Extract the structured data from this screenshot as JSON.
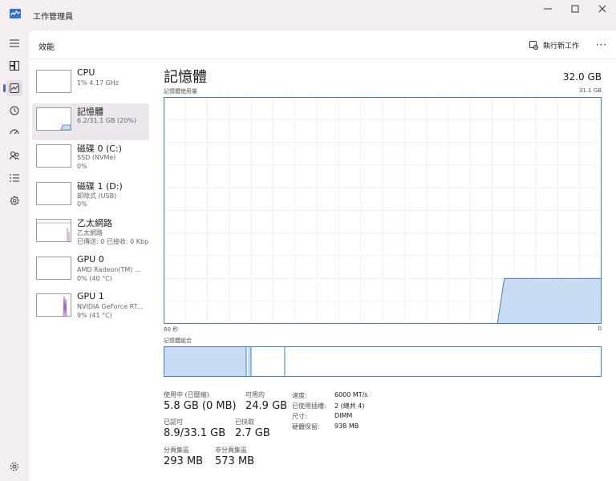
{
  "window": {
    "title": "工作管理員"
  },
  "header": {
    "page_title": "效能",
    "run_task_label": "執行新工作",
    "more_label": "···"
  },
  "devices": [
    {
      "name": "CPU",
      "line2": "1% 4.17 GHz",
      "line3": ""
    },
    {
      "name": "記憶體",
      "line2": "6.2/31.1 GB (20%)",
      "line3": ""
    },
    {
      "name": "磁碟 0 (C:)",
      "line2": "SSD (NVMe)",
      "line3": "0%"
    },
    {
      "name": "磁碟 1 (D:)",
      "line2": "卸除式 (USB)",
      "line3": "0%"
    },
    {
      "name": "乙太網路",
      "line2": "乙太網路",
      "line3": "已傳送: 0 已接收: 0 Kbp"
    },
    {
      "name": "GPU 0",
      "line2": "AMD Radeon(TM) ...",
      "line3": "0% (40 °C)"
    },
    {
      "name": "GPU 1",
      "line2": "NVIDIA GeForce RT...",
      "line3": "9% (41 °C)"
    }
  ],
  "main": {
    "title": "記憶體",
    "total": "32.0 GB",
    "graph_label": "記憶體使用量",
    "graph_max": "31.1 GB",
    "axis_left": "60 秒",
    "axis_right": "0",
    "composition_label": "記憶體組合",
    "usage_fraction_latest": 0.2
  },
  "stats": {
    "in_use_label": "使用中 (已壓縮)",
    "in_use_value": "5.8 GB (0 MB)",
    "available_label": "可用的",
    "available_value": "24.9 GB",
    "committed_label": "已認可",
    "committed_value": "8.9/33.1 GB",
    "cached_label": "已快取",
    "cached_value": "2.7 GB",
    "paged_label": "分頁集區",
    "paged_value": "293 MB",
    "nonpaged_label": "非分頁集區",
    "nonpaged_value": "573 MB"
  },
  "specs": [
    {
      "key": "速度:",
      "value": "6000 MT/s"
    },
    {
      "key": "已使用插槽:",
      "value": "2 (總共 4)"
    },
    {
      "key": "尺寸:",
      "value": "DIMM"
    },
    {
      "key": "硬體保留:",
      "value": "938 MB"
    }
  ],
  "colors": {
    "memory_stroke": "#3f7fc6",
    "memory_fill": "#c8ddf4",
    "network_line": "#c25a8a",
    "gpu_line": "#8a3fc2",
    "accent": "#3f6fb7"
  }
}
